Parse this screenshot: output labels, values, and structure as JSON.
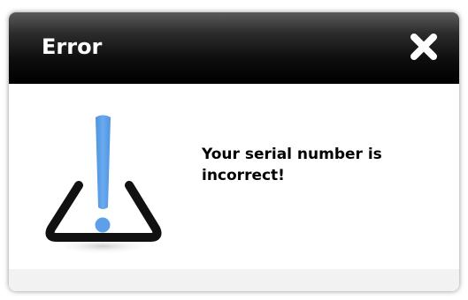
{
  "dialog": {
    "title": "Error",
    "message": "Your serial number is incorrect!",
    "icons": {
      "close": "close-x-icon",
      "warning": "warning-exclamation-icon"
    },
    "colors": {
      "titlebar": "#000000",
      "title_text": "#ffffff",
      "exclamation": "#5ea0e8",
      "triangle": "#111111",
      "footer": "#f2f2f2"
    }
  }
}
